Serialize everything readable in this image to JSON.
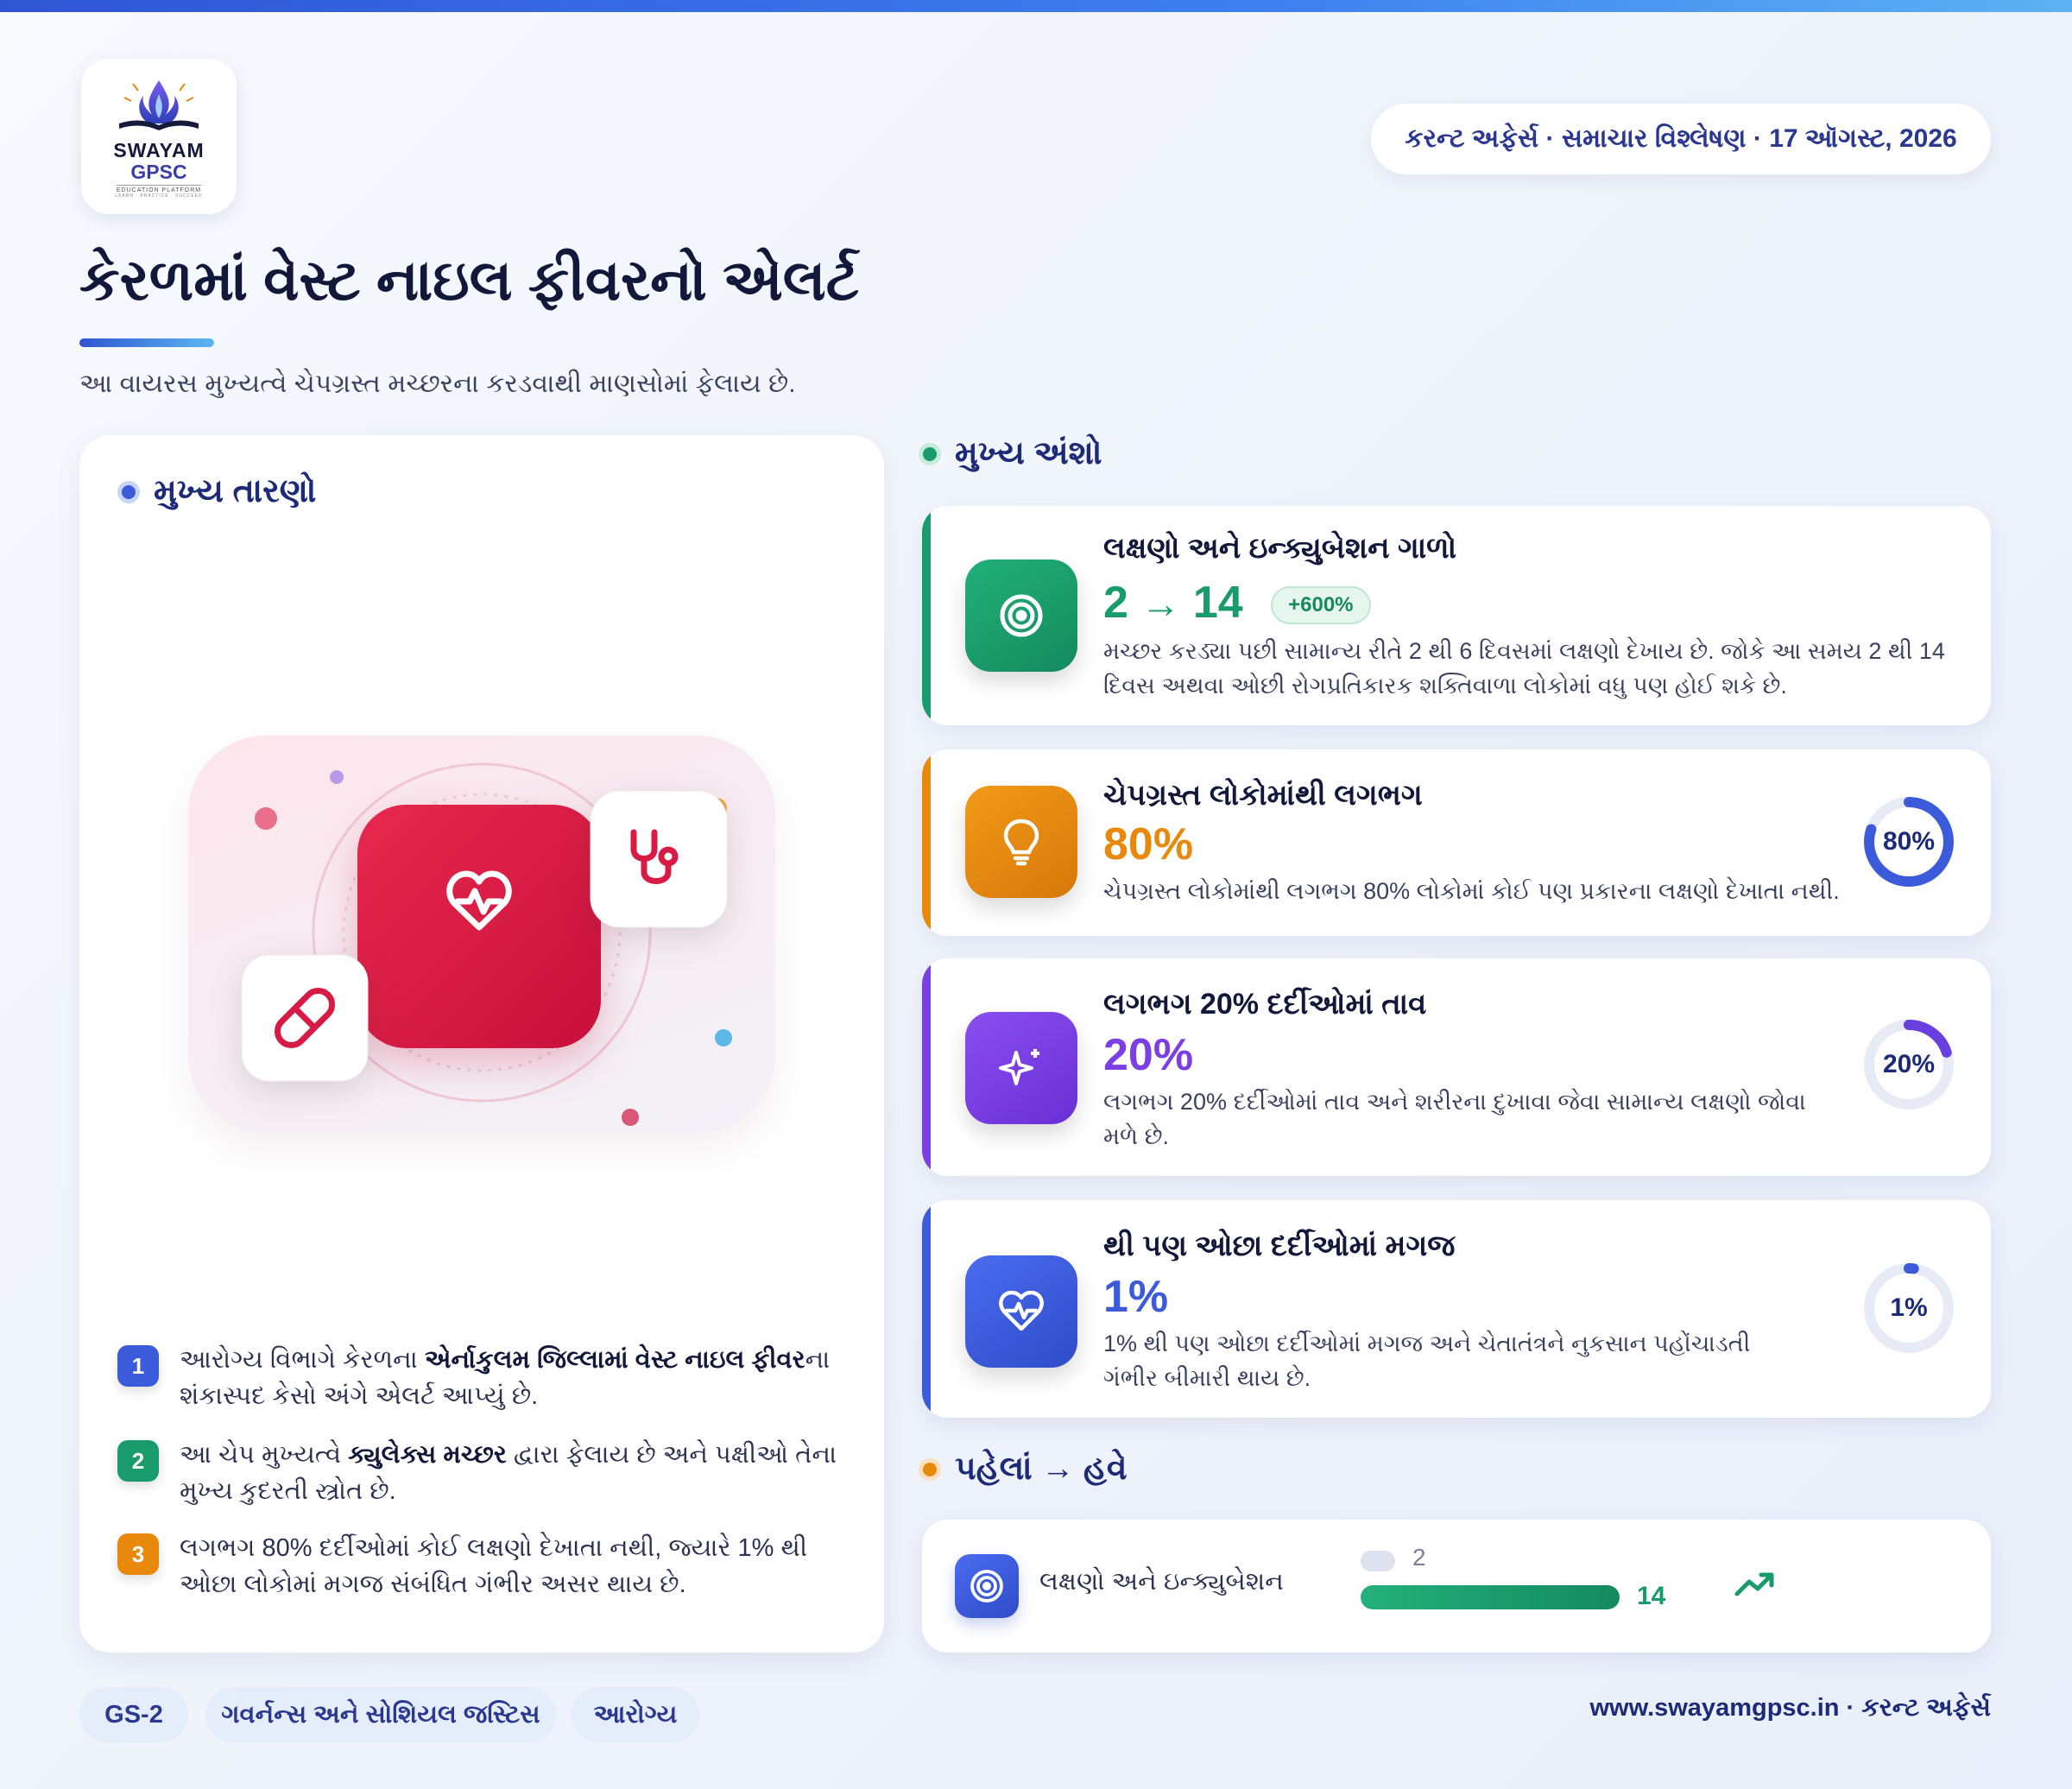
{
  "brand": {
    "name_line1": "SWAYAM",
    "name_line2": "GPSC",
    "tagline": "EDUCATION PLATFORM",
    "motto": "LEARN · PRACTICE · SUCCEED"
  },
  "header": {
    "date_pill": "કરન્ટ અફેર્સ · સમાચાર વિશ્લેષણ · 17 ઑગસ્ટ, 2026",
    "title": "કેરળમાં વેસ્ટ નાઇલ ફીવરનો એલર્ટ",
    "subtitle": "આ વાયરસ મુખ્યત્વે ચેપગ્રસ્ત મચ્છરના કરડવાથી માણસોમાં ફેલાય છે."
  },
  "findings": {
    "heading": "મુખ્ય તારણો",
    "items": [
      {
        "num": "1",
        "pre": "આરોગ્ય વિભાગે કેરળના ",
        "bold": "એર્નાકુલમ જિલ્લામાં વેસ્ટ નાઇલ ફીવર",
        "post": "ના શંકાસ્પદ કેસો અંગે એલર્ટ આપ્યું છે.",
        "color": "#3b5bdb"
      },
      {
        "num": "2",
        "pre": "આ ચેપ મુખ્યત્વે ",
        "bold": "ક્યુલેક્સ મચ્છર",
        "post": " દ્વારા ફેલાય છે અને પક્ષીઓ તેના મુખ્ય કુદરતી સ્ત્રોત છે.",
        "color": "#1a9b6b"
      },
      {
        "num": "3",
        "pre": "લગભગ 80% દર્દીઓમાં કોઈ લક્ષણો દેખાતા નથી, જ્યારે 1% થી ઓછા લોકોમાં મગજ સંબંધિત ગંભીર અસર થાય છે.",
        "bold": "",
        "post": "",
        "color": "#e8890c"
      }
    ]
  },
  "highlights": {
    "heading": "મુખ્ય અંશો",
    "cards": [
      {
        "title": "લક્ષણો અને ઇન્ક્યુબેશન ગાળો",
        "from": "2",
        "to": "14",
        "chip": "+600%",
        "desc": "મચ્છર કરડ્યા પછી સામાન્ય રીતે 2 થી 6 દિવસમાં લક્ષણો દેખાય છે. જોકે આ સમય 2 થી 14 દિવસ અથવા ઓછી રોગપ્રતિકારક શક્તિવાળા લોકોમાં વધુ પણ હોઈ શકે છે.",
        "icon": "target-icon",
        "color": "#1a9b6b"
      },
      {
        "title": "ચેપગ્રસ્ત લોકોમાંથી લગભગ",
        "value": "80%",
        "percent": 80,
        "desc": "ચેપગ્રસ્ત લોકોમાંથી લગભગ 80% લોકોમાં કોઈ પણ પ્રકારના લક્ષણો દેખાતા નથી.",
        "icon": "lightbulb-icon",
        "color": "#e8890c",
        "ring_color": "#3b5bdb"
      },
      {
        "title": "લગભગ 20% દર્દીઓમાં તાવ",
        "value": "20%",
        "percent": 20,
        "desc": "લગભગ 20% દર્દીઓમાં તાવ અને શરીરના દુખાવા જેવા સામાન્ય લક્ષણો જોવા મળે છે.",
        "icon": "sparkle-icon",
        "color": "#7b3fe4",
        "ring_color": "#6a3fe0"
      },
      {
        "title": "થી પણ ઓછા દર્દીઓમાં મગજ",
        "value": "1%",
        "percent": 1,
        "desc": "1% થી પણ ઓછા દર્દીઓમાં મગજ અને ચેતાતંત્રને નુકસાન પહોંચાડતી ગંભીર બીમારી થાય છે.",
        "icon": "heart-pulse-icon",
        "color": "#3b5bdb",
        "ring_color": "#3b5bdb"
      }
    ]
  },
  "before_now": {
    "heading": "પહેલાં → હવે",
    "label": "લક્ષણો અને ઇન્ક્યુબેશન",
    "before": "2",
    "now": "14",
    "before_fraction": 0.05,
    "now_fraction": 1.0,
    "icon": "trend-up-icon"
  },
  "tags": [
    "GS-2",
    "ગવર્નન્સ અને સોશિયલ જસ્ટિસ",
    "આરોગ્ય"
  ],
  "footer": "www.swayamgpsc.in · કરન્ટ અફેર્સ",
  "colors": {
    "primary": "#2a3890",
    "accent_blue": "#3b5bdb",
    "green": "#1a9b6b",
    "orange": "#e8890c",
    "purple": "#7b3fe4",
    "red": "#d81b44"
  }
}
